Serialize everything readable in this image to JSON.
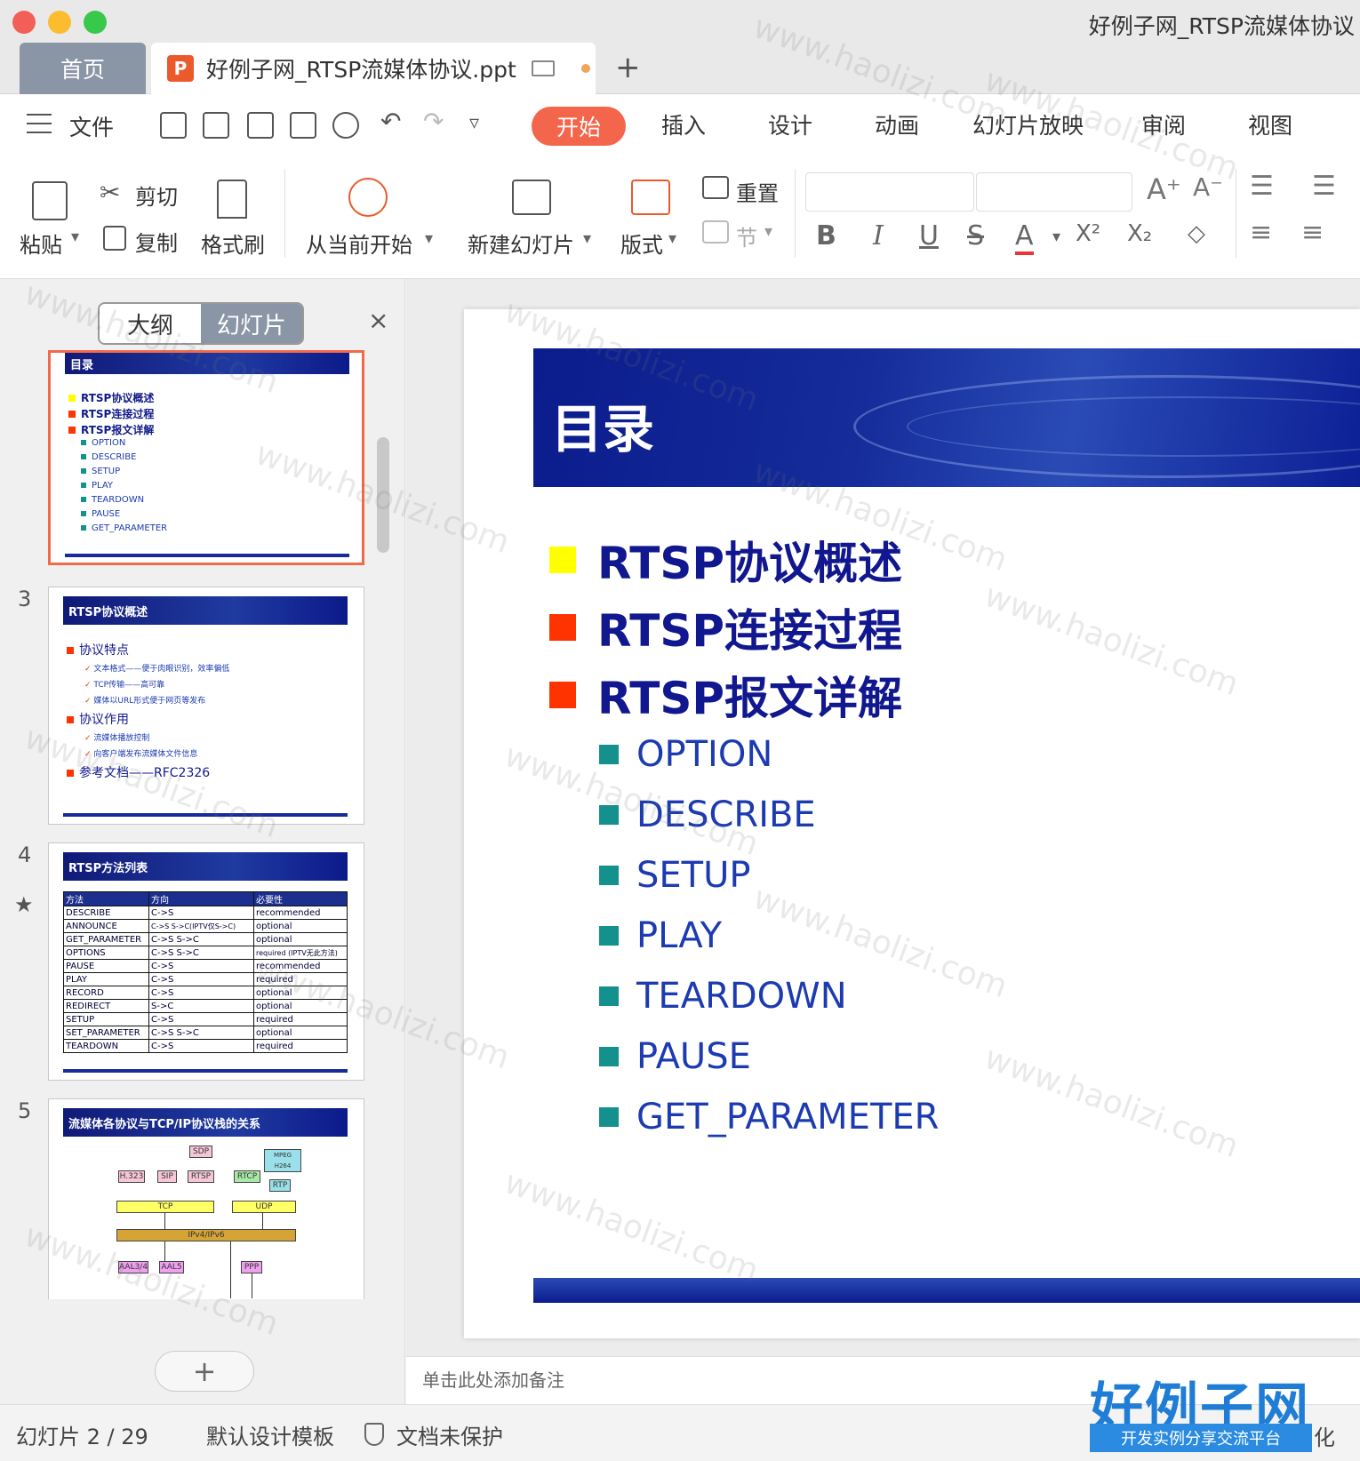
{
  "window": {
    "title": "好例子网_RTSP流媒体协议",
    "home_tab": "首页",
    "doc_tab": "好例子网_RTSP流媒体协议.ppt",
    "doc_badge": "P",
    "add_tab": "+"
  },
  "menu": {
    "file": "文件",
    "tabs": [
      "开始",
      "插入",
      "设计",
      "动画",
      "幻灯片放映",
      "审阅",
      "视图"
    ],
    "active": "开始"
  },
  "ribbon": {
    "paste": "粘贴",
    "cut": "剪切",
    "copy": "复制",
    "format_painter": "格式刷",
    "from_current": "从当前开始",
    "new_slide": "新建幻灯片",
    "layout": "版式",
    "reset": "重置",
    "section": "节",
    "bold": "B",
    "italic": "I",
    "underline": "U",
    "strike": "S",
    "font_color": "A"
  },
  "left_panel": {
    "outline_tab": "大纲",
    "slides_tab": "幻灯片",
    "close": "×",
    "add": "+",
    "slide2": {
      "title": "目录",
      "items_l1": [
        "RTSP协议概述",
        "RTSP连接过程",
        "RTSP报文详解"
      ],
      "items_l2": [
        "OPTION",
        "DESCRIBE",
        "SETUP",
        "PLAY",
        "TEARDOWN",
        "PAUSE",
        "GET_PARAMETER"
      ]
    },
    "slide3": {
      "num": "3",
      "title": "RTSP协议概述",
      "h1": "协议特点",
      "h1_items": [
        "文本格式——便于肉眼识别，效率偏低",
        "TCP传输——高可靠",
        "媒体以URL形式便于网页等发布"
      ],
      "h2": "协议作用",
      "h2_items": [
        "流媒体播放控制",
        "向客户端发布流媒体文件信息"
      ],
      "h3": "参考文档——RFC2326"
    },
    "slide4": {
      "num": "4",
      "title": "RTSP方法列表",
      "headers": [
        "方法",
        "方向",
        "必要性"
      ],
      "rows": [
        [
          "DESCRIBE",
          "C->S",
          "recommended"
        ],
        [
          "ANNOUNCE",
          "C->S S->C(IPTV仅S->C)",
          "optional"
        ],
        [
          "GET_PARAMETER",
          "C->S S->C",
          "optional"
        ],
        [
          "OPTIONS",
          "C->S S->C",
          "required (IPTV无此方法)"
        ],
        [
          "PAUSE",
          "C->S",
          "recommended"
        ],
        [
          "PLAY",
          "C->S",
          "required"
        ],
        [
          "RECORD",
          "C->S",
          "optional"
        ],
        [
          "REDIRECT",
          "S->C",
          "optional"
        ],
        [
          "SETUP",
          "C->S",
          "required"
        ],
        [
          "SET_PARAMETER",
          "C->S S->C",
          "optional"
        ],
        [
          "TEARDOWN",
          "C->S",
          "required"
        ]
      ]
    },
    "slide5": {
      "num": "5",
      "title": "流媒体各协议与TCP/IP协议栈的关系",
      "boxes": [
        "SDP",
        "MPEG H264",
        "H.323",
        "SIP",
        "RTSP",
        "RTCP",
        "RTP",
        "TCP",
        "UDP",
        "IPv4/IPv6",
        "AAL3/4",
        "AAL5",
        "PPP"
      ]
    }
  },
  "slide": {
    "title": "目录",
    "l1": [
      {
        "text": "RTSP协议概述",
        "color": "#ffff00"
      },
      {
        "text": "RTSP连接过程",
        "color": "#ff3300"
      },
      {
        "text": "RTSP报文详解",
        "color": "#ff3300"
      }
    ],
    "l2": [
      "OPTION",
      "DESCRIBE",
      "SETUP",
      "PLAY",
      "TEARDOWN",
      "PAUSE",
      "GET_PARAMETER"
    ]
  },
  "notes": {
    "placeholder": "单击此处添加备注"
  },
  "status": {
    "slide_counter": "幻灯片 2 / 29",
    "template": "默认设计模板",
    "protection": "文档未保护",
    "tail": "化"
  },
  "brand": {
    "name": "好例子网",
    "slogan": "开发实例分享交流平台"
  },
  "watermark": "www.haolizi.com",
  "colors": {
    "accent": "#f4664b",
    "slide_blue": "#11188f",
    "bullet_teal": "#14918c"
  }
}
